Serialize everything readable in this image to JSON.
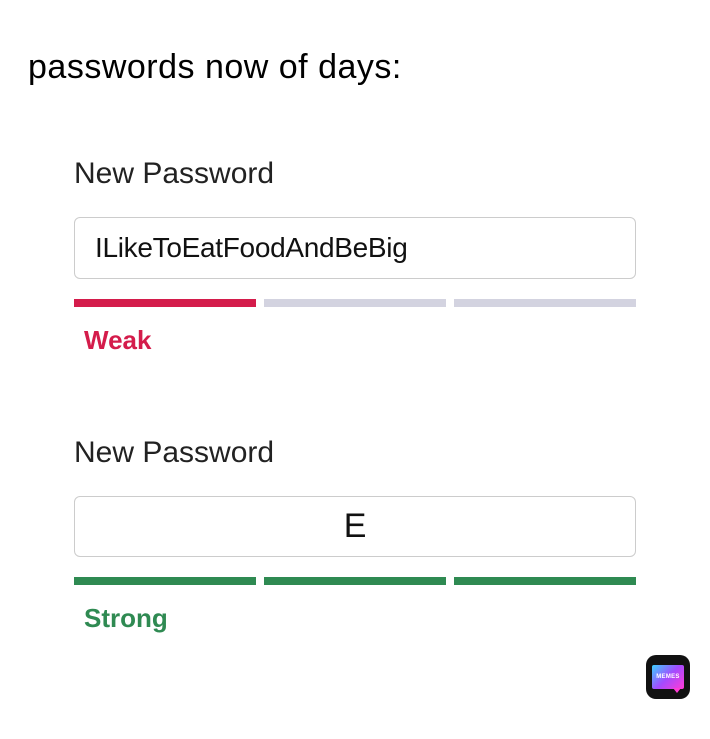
{
  "caption": "passwords now of days:",
  "panels": [
    {
      "label": "New Password",
      "value": "ILikeToEatFoodAndBeBig",
      "strength_label": "Weak",
      "segments": [
        "red",
        "grey",
        "grey"
      ]
    },
    {
      "label": "New Password",
      "value": "E",
      "strength_label": "Strong",
      "segments": [
        "green",
        "green",
        "green"
      ]
    }
  ],
  "colors": {
    "weak": "#d41c4b",
    "strong": "#2f8a52",
    "inactive_segment": "#d3d3e0"
  },
  "watermark": "MEMES"
}
